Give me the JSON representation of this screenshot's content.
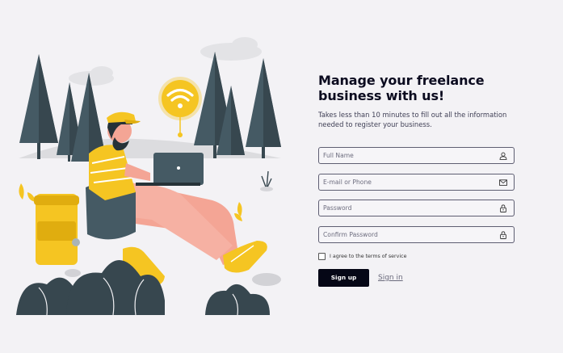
{
  "form": {
    "title_line1": "Manage your freelance",
    "title_line2": "business with us!",
    "subtitle": "Takes less than 10 minutes to fill out all the information needed to register your business.",
    "fields": [
      {
        "placeholder": "Full Name",
        "value": "",
        "icon": "user-icon"
      },
      {
        "placeholder": "E-mail or Phone",
        "value": "",
        "icon": "mail-icon"
      },
      {
        "placeholder": "Password",
        "value": "",
        "icon": "lock-icon"
      },
      {
        "placeholder": "Confirm Password",
        "value": "",
        "icon": "lock-icon"
      }
    ],
    "terms_label": "I agree to the terms of service",
    "terms_checked": false,
    "signup_label": "Sign up",
    "signin_label": "Sign in"
  },
  "illustration": {
    "subject": "person-with-laptop",
    "icon": "wifi-icon",
    "colors": {
      "yellow": "#f5c522",
      "skin": "#f4a595",
      "dark": "#37474f",
      "tree": "#455a64",
      "ground": "#e6e6e8"
    }
  },
  "colors": {
    "background": "#f3f2f5",
    "button": "#050716",
    "field_border": "#5e5e72",
    "link": "#6a6a7c"
  }
}
